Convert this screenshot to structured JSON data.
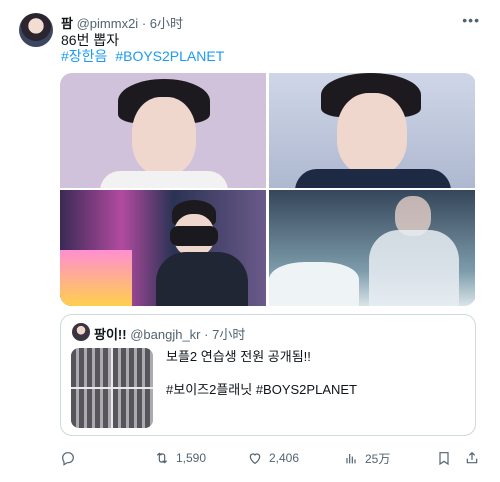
{
  "tweet": {
    "name": "팜",
    "handle": "@pimmx2i",
    "dot": "·",
    "time": "6小时",
    "text": "86번 뽑자",
    "hashtags": [
      "#장한음",
      "#BOYS2PLANET"
    ],
    "media": [
      {
        "icon": "photo-1"
      },
      {
        "icon": "photo-2"
      },
      {
        "icon": "photo-3"
      },
      {
        "icon": "photo-4"
      }
    ],
    "quote": {
      "name": "팡이!!",
      "handle": "@bangjh_kr",
      "dot": "·",
      "time": "7小时",
      "text": "보플2 연습생 전원 공개됨!!",
      "tags": "#보이즈2플래닛 #BOYS2PLANET"
    },
    "actions": {
      "reply_icon": "reply-icon",
      "retweet_count": "1,590",
      "like_count": "2,406",
      "view_count": "25万",
      "bookmark_icon": "bookmark-icon",
      "share_icon": "share-icon"
    },
    "colors": {
      "link": "#1d9bf0",
      "muted": "#536471",
      "border": "#cfd9de"
    }
  }
}
